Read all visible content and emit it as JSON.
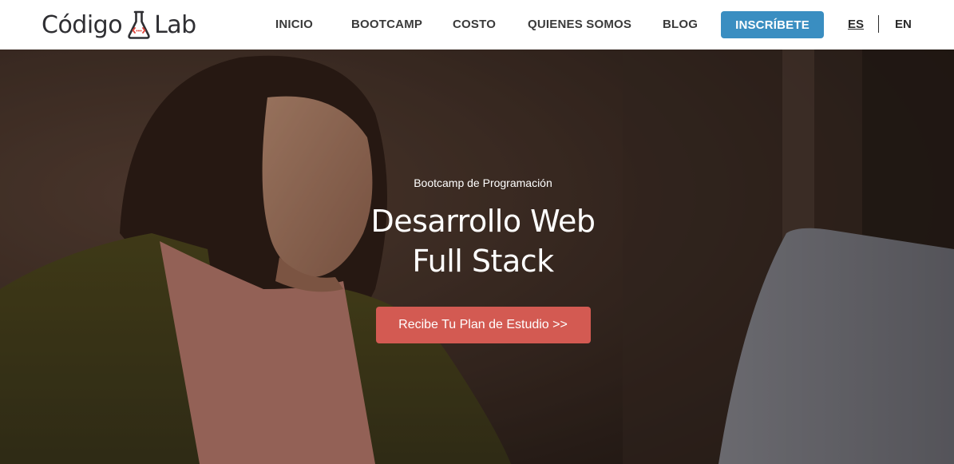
{
  "brand": {
    "name_left": "Código",
    "name_right": "Lab",
    "logo_icon": "flask-icon",
    "accent_color": "#3a8ec1",
    "cta_color": "#d35a52"
  },
  "nav": {
    "items": [
      {
        "label": "INICIO"
      },
      {
        "label": "BOOTCAMP"
      },
      {
        "label": "COSTO"
      },
      {
        "label": "QUIENES SOMOS"
      },
      {
        "label": "BLOG"
      }
    ],
    "enroll_label": "INSCRÍBETE",
    "languages": [
      {
        "label": "ES",
        "active": true
      },
      {
        "label": "EN",
        "active": false
      }
    ]
  },
  "hero": {
    "kicker": "Bootcamp de Programación",
    "title_line1": "Desarrollo Web",
    "title_line2": "Full Stack",
    "cta_label": "Recibe Tu Plan de Estudio >>"
  }
}
